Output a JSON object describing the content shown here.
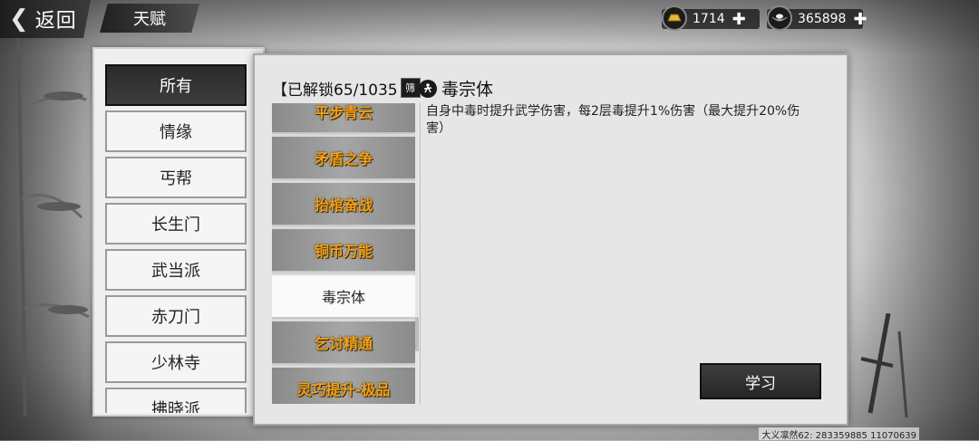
{
  "topbar": {
    "back_label": "返回",
    "title": "天赋"
  },
  "currency": {
    "gold_amount": "1714",
    "silver_amount": "365898"
  },
  "categories": {
    "items": [
      "所有",
      "情缘",
      "丐帮",
      "长生门",
      "武当派",
      "赤刀门",
      "少林寺",
      "拂晓派"
    ],
    "active": "所有"
  },
  "talents": {
    "unlock_status": "【已解锁65/1035",
    "sort_badge": "筛",
    "list": [
      "平步青云",
      "矛盾之争",
      "抬棺奋战",
      "铜币万能",
      "毒宗体",
      "乞讨精通",
      "灵巧提升-极品"
    ],
    "selected": "毒宗体"
  },
  "detail": {
    "name": "毒宗体",
    "description": "自身中毒时提升武学伤害，每2层毒提升1%伤害（最大提升20%伤害）"
  },
  "actions": {
    "learn_label": "学习"
  },
  "footer": {
    "text": "大义凛然62: 283359885 11070639"
  },
  "colors": {
    "talent_text": "#f0a020",
    "active_category_bg": "#2b2b2b"
  }
}
